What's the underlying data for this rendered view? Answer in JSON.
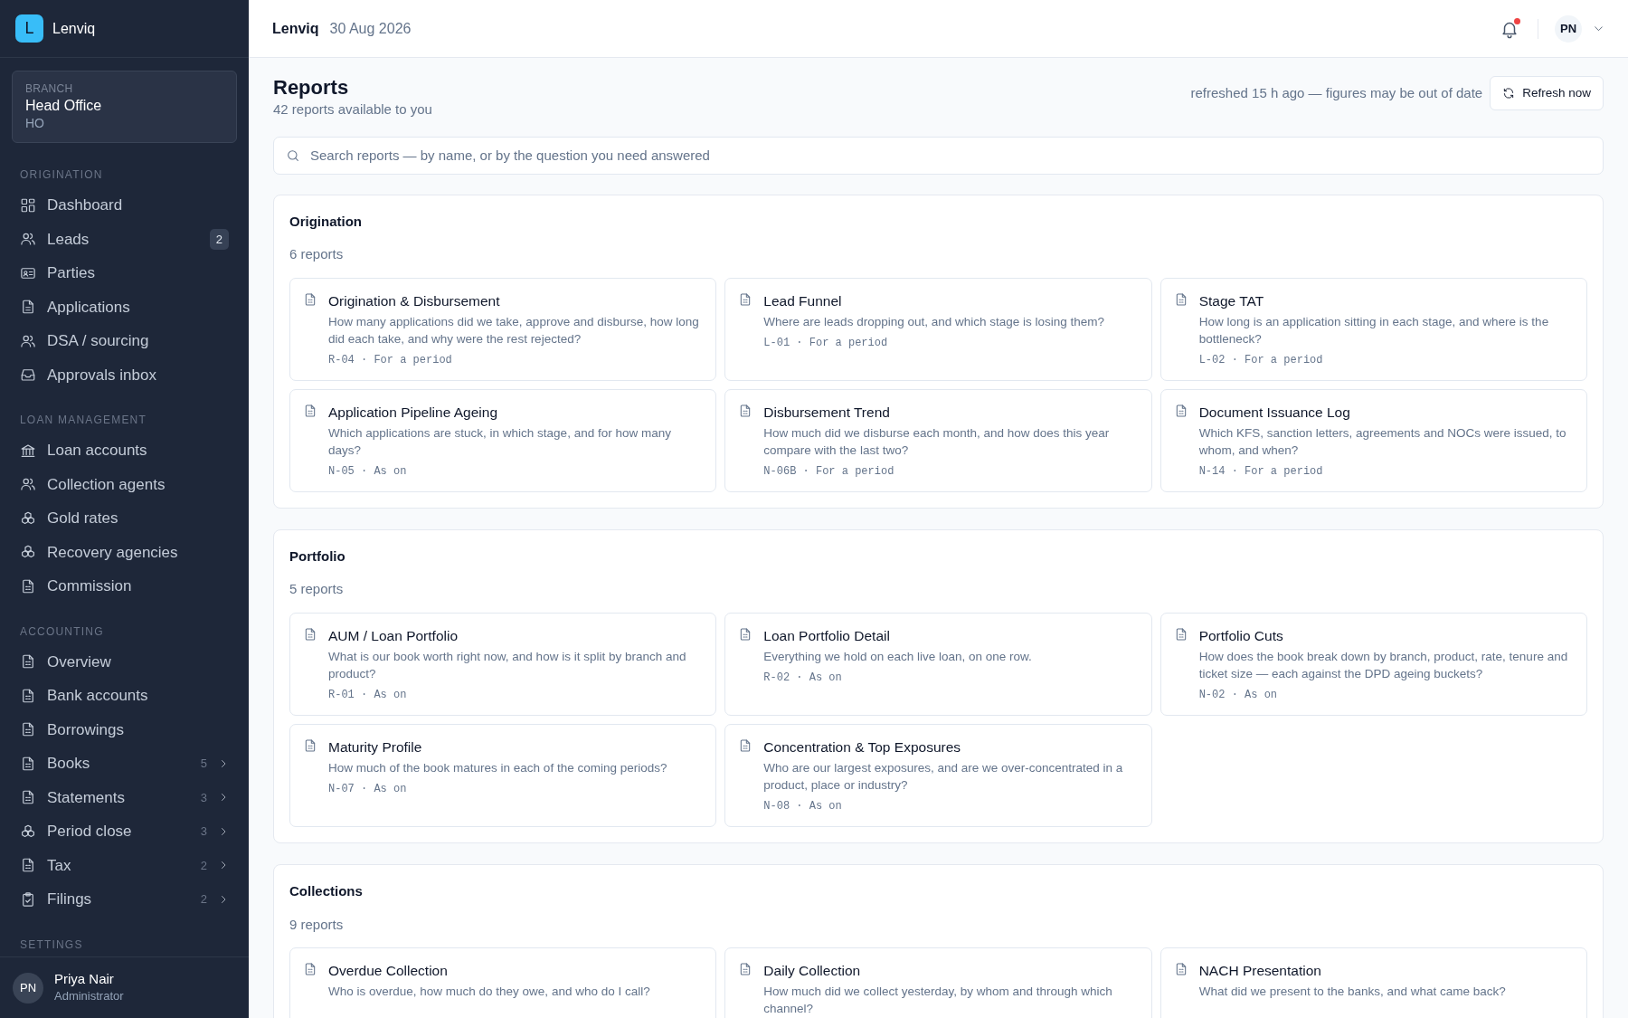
{
  "app": {
    "logo_letter": "L",
    "name": "Lenviq"
  },
  "branch": {
    "label": "BRANCH",
    "name": "Head Office",
    "code": "HO"
  },
  "sidebar": {
    "sections": [
      {
        "title": "ORIGINATION",
        "items": [
          {
            "label": "Dashboard"
          },
          {
            "label": "Leads",
            "badge": "2"
          },
          {
            "label": "Parties"
          },
          {
            "label": "Applications"
          },
          {
            "label": "DSA / sourcing"
          },
          {
            "label": "Approvals inbox"
          }
        ]
      },
      {
        "title": "LOAN MANAGEMENT",
        "items": [
          {
            "label": "Loan accounts"
          },
          {
            "label": "Collection agents"
          },
          {
            "label": "Gold rates"
          },
          {
            "label": "Recovery agencies"
          },
          {
            "label": "Commission"
          }
        ]
      },
      {
        "title": "ACCOUNTING",
        "items": [
          {
            "label": "Overview"
          },
          {
            "label": "Bank accounts"
          },
          {
            "label": "Borrowings"
          },
          {
            "label": "Books",
            "count": "5"
          },
          {
            "label": "Statements",
            "count": "3"
          },
          {
            "label": "Period close",
            "count": "3"
          },
          {
            "label": "Tax",
            "count": "2"
          },
          {
            "label": "Filings",
            "count": "2"
          }
        ]
      },
      {
        "title": "SETTINGS"
      }
    ]
  },
  "user": {
    "initials": "PN",
    "name": "Priya Nair",
    "role": "Administrator"
  },
  "topbar": {
    "brand": "Lenviq",
    "date": "30 Aug 2026",
    "notification_dot": true,
    "user_initials": "PN"
  },
  "page": {
    "title": "Reports",
    "subtitle": "42 reports available to you",
    "refresh_note": "refreshed 15 h ago — figures may be out of date",
    "refresh_button": "Refresh now",
    "search_placeholder": "Search reports — by name, or by the question you need answered"
  },
  "groups": [
    {
      "title": "Origination",
      "count": "6 reports",
      "reports": [
        {
          "title": "Origination & Disbursement",
          "question": "How many applications did we take, approve and disburse, how long did each take, and why were the rest rejected?",
          "meta": "R-04 · For a period"
        },
        {
          "title": "Lead Funnel",
          "question": "Where are leads dropping out, and which stage is losing them?",
          "meta": "L-01 · For a period"
        },
        {
          "title": "Stage TAT",
          "question": "How long is an application sitting in each stage, and where is the bottleneck?",
          "meta": "L-02 · For a period"
        },
        {
          "title": "Application Pipeline Ageing",
          "question": "Which applications are stuck, in which stage, and for how many days?",
          "meta": "N-05 · As on"
        },
        {
          "title": "Disbursement Trend",
          "question": "How much did we disburse each month, and how does this year compare with the last two?",
          "meta": "N-06B · For a period"
        },
        {
          "title": "Document Issuance Log",
          "question": "Which KFS, sanction letters, agreements and NOCs were issued, to whom, and when?",
          "meta": "N-14 · For a period"
        }
      ]
    },
    {
      "title": "Portfolio",
      "count": "5 reports",
      "reports": [
        {
          "title": "AUM / Loan Portfolio",
          "question": "What is our book worth right now, and how is it split by branch and product?",
          "meta": "R-01 · As on"
        },
        {
          "title": "Loan Portfolio Detail",
          "question": "Everything we hold on each live loan, on one row.",
          "meta": "R-02 · As on"
        },
        {
          "title": "Portfolio Cuts",
          "question": "How does the book break down by branch, product, rate, tenure and ticket size — each against the DPD ageing buckets?",
          "meta": "N-02 · As on"
        },
        {
          "title": "Maturity Profile",
          "question": "How much of the book matures in each of the coming periods?",
          "meta": "N-07 · As on"
        },
        {
          "title": "Concentration & Top Exposures",
          "question": "Who are our largest exposures, and are we over-concentrated in a product, place or industry?",
          "meta": "N-08 · As on"
        }
      ]
    },
    {
      "title": "Collections",
      "count": "9 reports",
      "reports": [
        {
          "title": "Overdue Collection",
          "question": "Who is overdue, how much do they owe, and who do I call?"
        },
        {
          "title": "Daily Collection",
          "question": "How much did we collect yesterday, by whom and through which channel?"
        },
        {
          "title": "NACH Presentation",
          "question": "What did we present to the banks, and what came back?"
        }
      ]
    }
  ]
}
